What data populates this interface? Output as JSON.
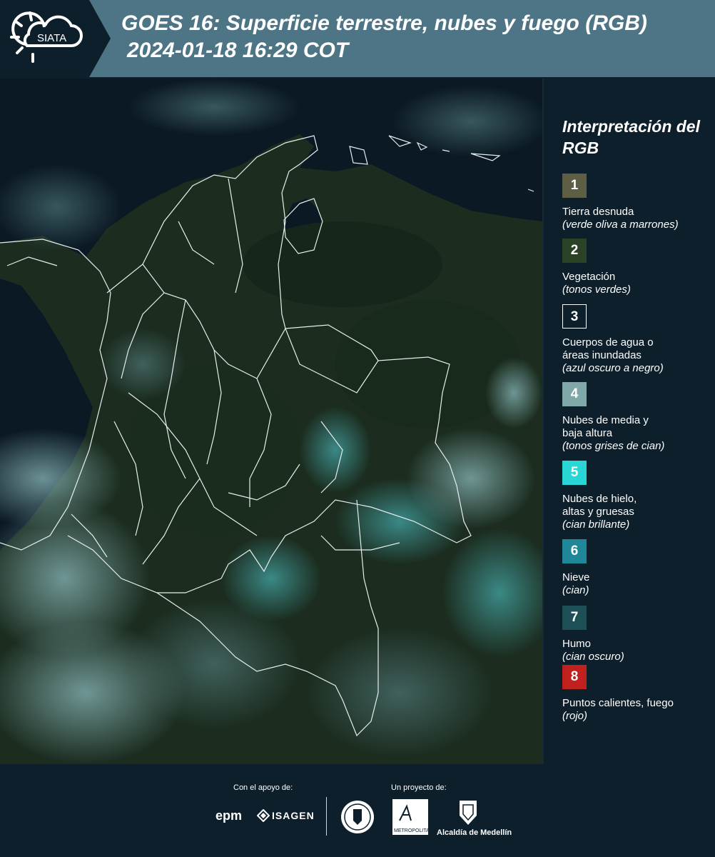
{
  "header": {
    "logo_text": "SIATA",
    "title_line1": "GOES 16: Superficie terrestre, nubes y fuego (RGB)",
    "title_line2": "2024-01-18 16:29 COT",
    "bg_color": "#4d7585",
    "logo_bg_color": "#0c1f2b"
  },
  "map": {
    "description_icon": "satellite-map-colombia",
    "land_color": "#1f2f22",
    "cloud_color": "#7fb3b5",
    "border_color": "#ffffff"
  },
  "legend": {
    "title": "Interpretación del RGB",
    "items": [
      {
        "number": "1",
        "label": "Tierra desnuda",
        "desc": "(verde oliva a marrones)",
        "color": "#5e5e45"
      },
      {
        "number": "2",
        "label": "Vegetación",
        "desc": "(tonos verdes)",
        "color": "#2c4226"
      },
      {
        "number": "3",
        "label": "Cuerpos de agua o\náreas inundadas",
        "desc": "(azul oscuro a negro)",
        "color": "#0c1f2b"
      },
      {
        "number": "4",
        "label": "Nubes de media y\nbaja altura",
        "desc": "(tonos grises de cian)",
        "color": "#7fa9a9"
      },
      {
        "number": "5",
        "label": "Nubes de hielo,\naltas y gruesas",
        "desc": "(cian brillante)",
        "color": "#29d6d6"
      },
      {
        "number": "6",
        "label": "Nieve",
        "desc": "(cian)",
        "color": "#1f8898"
      },
      {
        "number": "7",
        "label": "Humo",
        "desc": "(cian oscuro)",
        "color": "#1d4f56"
      },
      {
        "number": "8",
        "label": "Puntos calientes, fuego",
        "desc": "(rojo)",
        "color": "#c0201e"
      }
    ]
  },
  "footer": {
    "support_label": "Con el apoyo de:",
    "project_label": "Un proyecto de:",
    "sponsor1": "epm",
    "sponsor2": "ISAGEN",
    "partner_area_text": "Área",
    "partner_area_sub": "METROPOLITANA",
    "partner_alcaldia": "Alcaldía de Medellín"
  }
}
